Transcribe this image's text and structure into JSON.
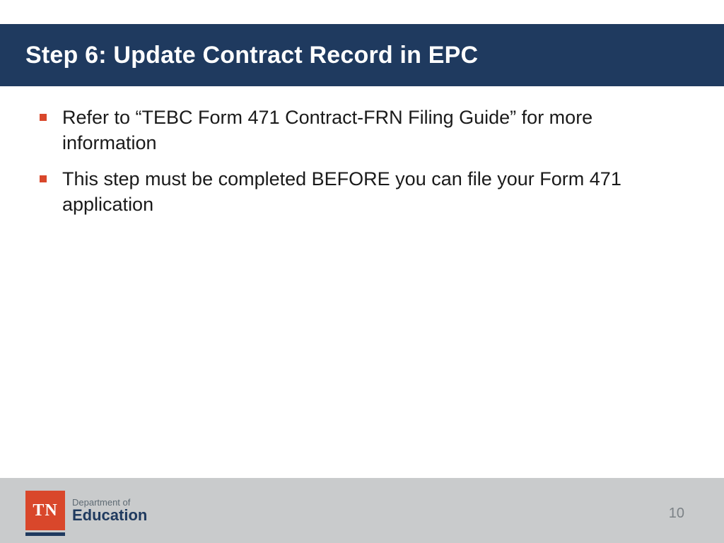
{
  "title": "Step 6: Update Contract Record in EPC",
  "bullets": [
    "Refer to “TEBC Form 471 Contract-FRN Filing Guide” for more information",
    "This step must be completed BEFORE you can file your Form 471 application"
  ],
  "footer": {
    "logo_state": "TN",
    "dept_line": "Department of",
    "edu_line": "Education",
    "page_number": "10"
  }
}
